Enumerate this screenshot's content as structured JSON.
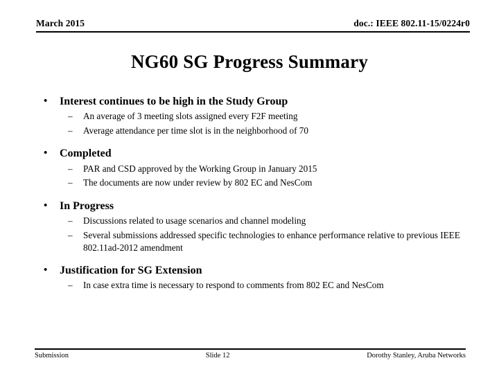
{
  "header": {
    "date": "March 2015",
    "doc_reference": "doc.: IEEE 802.11-15/0224r0"
  },
  "title": "NG60 SG Progress Summary",
  "body": {
    "groups": [
      {
        "heading": "Interest continues to be high in the Study Group",
        "items": [
          "An average of 3 meeting slots assigned every F2F meeting",
          "Average attendance per time slot is in the neighborhood of 70"
        ]
      },
      {
        "heading": "Completed",
        "items": [
          "PAR and CSD approved by the Working Group in January 2015",
          "The documents are now under review by 802 EC and NesCom"
        ]
      },
      {
        "heading": "In Progress",
        "items": [
          "Discussions related to usage scenarios and channel modeling",
          "Several submissions addressed specific technologies to enhance performance relative to previous IEEE 802.11ad-2012 amendment"
        ]
      },
      {
        "heading": "Justification for SG Extension",
        "items": [
          "In case extra time is necessary to respond to comments from 802 EC and NesCom"
        ]
      }
    ],
    "level1_marker": "•",
    "level2_marker": "–"
  },
  "footer": {
    "left": "Submission",
    "center": "Slide 12",
    "right": "Dorothy Stanley, Aruba Networks"
  }
}
